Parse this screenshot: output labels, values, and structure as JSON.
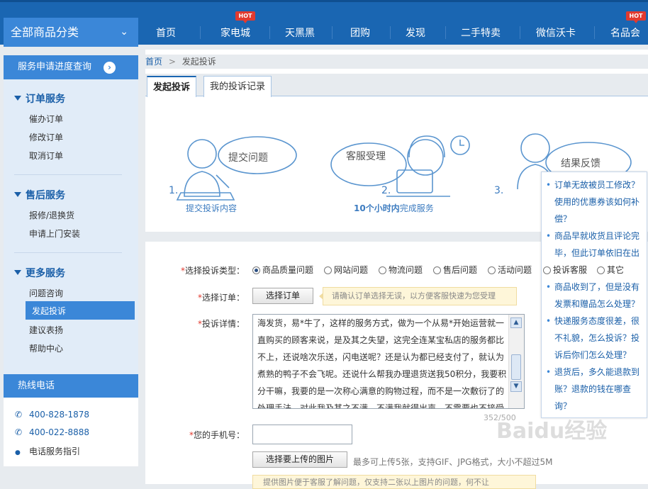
{
  "nav": {
    "all_categories": "全部商品分类",
    "items": [
      "首页",
      "家电城",
      "天黑黑",
      "团购",
      "发现",
      "二手特卖",
      "微信沃卡",
      "名品会"
    ],
    "hot": "HOT"
  },
  "sidebar": {
    "progress_query": "服务申请进度查询",
    "sections": [
      {
        "title": "订单服务",
        "items": [
          "催办订单",
          "修改订单",
          "取消订单"
        ]
      },
      {
        "title": "售后服务",
        "items": [
          "报修/退换货",
          "申请上门安装"
        ]
      },
      {
        "title": "更多服务",
        "items": [
          "问题咨询",
          "发起投诉",
          "建议表扬",
          "帮助中心"
        ]
      }
    ],
    "active_item": "发起投诉"
  },
  "hotline": {
    "title": "热线电话",
    "phone1": "400-828-1878",
    "phone2": "400-022-8888",
    "guide": "电话服务指引"
  },
  "breadcrumb": {
    "home": "首页",
    "sep": ">",
    "current": "发起投诉"
  },
  "tabs": {
    "active": "发起投诉",
    "inactive": "我的投诉记录"
  },
  "steps": {
    "s1_bubble": "提交问题",
    "s1_num": "1.",
    "s1_caption": "提交投诉内容",
    "s2_bubble": "客服受理",
    "s2_num": "2.",
    "s2_caption_bold": "10个小时内",
    "s2_caption_rest": "完成服务",
    "s3_bubble": "结果反馈",
    "s3_num": "3."
  },
  "form": {
    "type_label": "选择投诉类型：",
    "type_options": [
      "商品质量问题",
      "网站问题",
      "物流问题",
      "售后问题",
      "活动问题",
      "其它"
    ],
    "type_overlap": "投诉客服",
    "selected": "商品质量问题",
    "order_label": "选择订单：",
    "order_button": "选择订单",
    "order_tip": "请确认订单选择无误，以方便客服快速为您受理",
    "detail_label": "投诉详情：",
    "detail_text": "海发货，易*牛了，这样的服务方式，做为一个从易*开始运营就一直购买的顾客来说，是及其之失望，这完全连某宝私店的服务都比不上，还说啥次乐送，闪电送呢？还是认为都已经支付了，就认为煮熟的鸭子不会飞呢。还说什么帮我办理退货送我50积分，我要积分干嘛，我要的是一次称心满意的购物过程，而不是一次敷衍了的处理手法，对此我及其之不满，不满我就得出声，不需要也不接受啥积分，我要一个满意的理由和一个合理的道歉。",
    "counter": "352/500",
    "phone_label": "您的手机号：",
    "upload_button": "选择要上传的图片",
    "upload_note": "最多可上传5张，支持GIF、JPG格式，大小不超过5M",
    "upload_tip": "提供图片便于客服了解问题，仅支持二张以上图片的问题，何不让"
  },
  "faq": [
    "订单无故被员工修改？使用的优惠券该如何补偿？",
    "商品早就收货且评论完毕，但此订单依旧在出库？",
    "商品收到了，但是没有发票和赠品怎么处理？",
    "快递服务态度很差，很不礼貌，怎么投诉？投诉后你们怎么处理？",
    "退货后，多久能退款到账？退款的钱在哪查询？"
  ],
  "watermark": "Baidu经验"
}
